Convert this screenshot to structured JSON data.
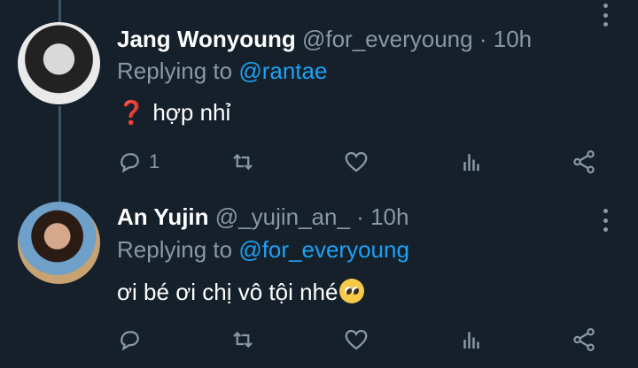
{
  "tweets": [
    {
      "name": "Jang Wonyoung",
      "handle": "@for_everyoung",
      "separator": "·",
      "time": "10h",
      "replying_prefix": "Replying to ",
      "replying_to": "@rantae",
      "text": "hợp nhỉ",
      "emoji": "❓",
      "reply_count": "1"
    },
    {
      "name": "An Yujin",
      "handle": "@_yujin_an_",
      "separator": "·",
      "time": "10h",
      "replying_prefix": "Replying to ",
      "replying_to": "@for_everyoung",
      "text": "ơi bé ơi chị vô tội nhé",
      "reply_count": ""
    }
  ],
  "colors": {
    "background": "#15202b",
    "secondary_text": "#8899a6",
    "mention": "#1da1f2"
  }
}
